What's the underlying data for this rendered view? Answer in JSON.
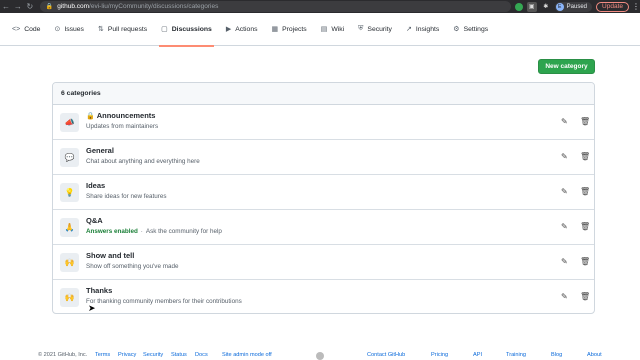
{
  "browser": {
    "url_host": "github.com",
    "url_path": "/evi-liu/myCommunity/discussions/categories",
    "profile_initial": "E",
    "profile_label": "Paused",
    "update_label": "Update"
  },
  "tabs": [
    {
      "label": "Code",
      "icon": "code-icon",
      "glyph": "<>"
    },
    {
      "label": "Issues",
      "icon": "issue-icon",
      "glyph": "⊙"
    },
    {
      "label": "Pull requests",
      "icon": "pull-request-icon",
      "glyph": "⇅"
    },
    {
      "label": "Discussions",
      "icon": "discussions-icon",
      "glyph": "▢"
    },
    {
      "label": "Actions",
      "icon": "actions-icon",
      "glyph": "▶"
    },
    {
      "label": "Projects",
      "icon": "projects-icon",
      "glyph": "▦"
    },
    {
      "label": "Wiki",
      "icon": "wiki-icon",
      "glyph": "▤"
    },
    {
      "label": "Security",
      "icon": "shield-icon",
      "glyph": "⛨"
    },
    {
      "label": "Insights",
      "icon": "graph-icon",
      "glyph": "↗"
    },
    {
      "label": "Settings",
      "icon": "gear-icon",
      "glyph": "⚙"
    }
  ],
  "new_category_label": "New category",
  "categories_count_label": "6 categories",
  "categories": [
    {
      "emoji": "📣",
      "title": "Announcements",
      "locked": true,
      "desc": "Updates from maintainers"
    },
    {
      "emoji": "💬",
      "title": "General",
      "desc": "Chat about anything and everything here"
    },
    {
      "emoji": "💡",
      "title": "Ideas",
      "desc": "Share ideas for new features"
    },
    {
      "emoji": "🙏",
      "title": "Q&A",
      "answers": "Answers enabled",
      "desc": "Ask the community for help"
    },
    {
      "emoji": "🙌",
      "title": "Show and tell",
      "desc": "Show off something you've made"
    },
    {
      "emoji": "🙌",
      "title": "Thanks",
      "desc": "For thanking community members for their contributions"
    }
  ],
  "footer": {
    "copyright": "© 2021 GitHub, Inc.",
    "left_links": [
      "Terms",
      "Privacy",
      "Security",
      "Status",
      "Docs",
      "Site admin mode off"
    ],
    "right_links": [
      "Contact GitHub",
      "Pricing",
      "API",
      "Training",
      "Blog",
      "About"
    ]
  }
}
